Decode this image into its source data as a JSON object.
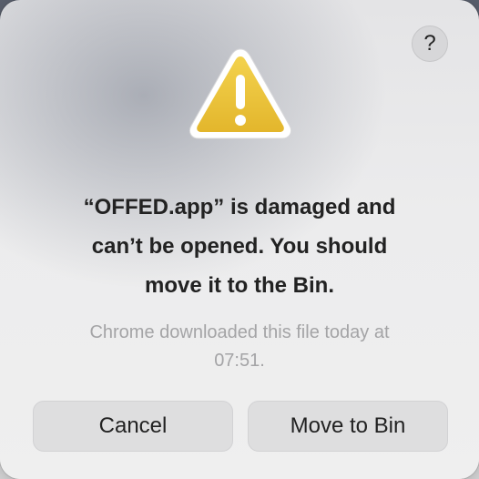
{
  "dialog": {
    "help_label": "?",
    "icon": "warning-triangle-icon",
    "title_line1": "“OFFED.app” is damaged and",
    "title_line2": "can’t be opened. You should",
    "title_line3": "move it to the Bin.",
    "message_line1": "Chrome downloaded this file today at",
    "message_line2": "07:51.",
    "cancel_label": "Cancel",
    "move_label": "Move to Bin"
  },
  "colors": {
    "warning_fill": "#EBC23A",
    "warning_border": "#FFFFFF",
    "text_primary": "#222222",
    "text_secondary": "#A4A4A6",
    "button_bg": "#DEDEDF"
  }
}
